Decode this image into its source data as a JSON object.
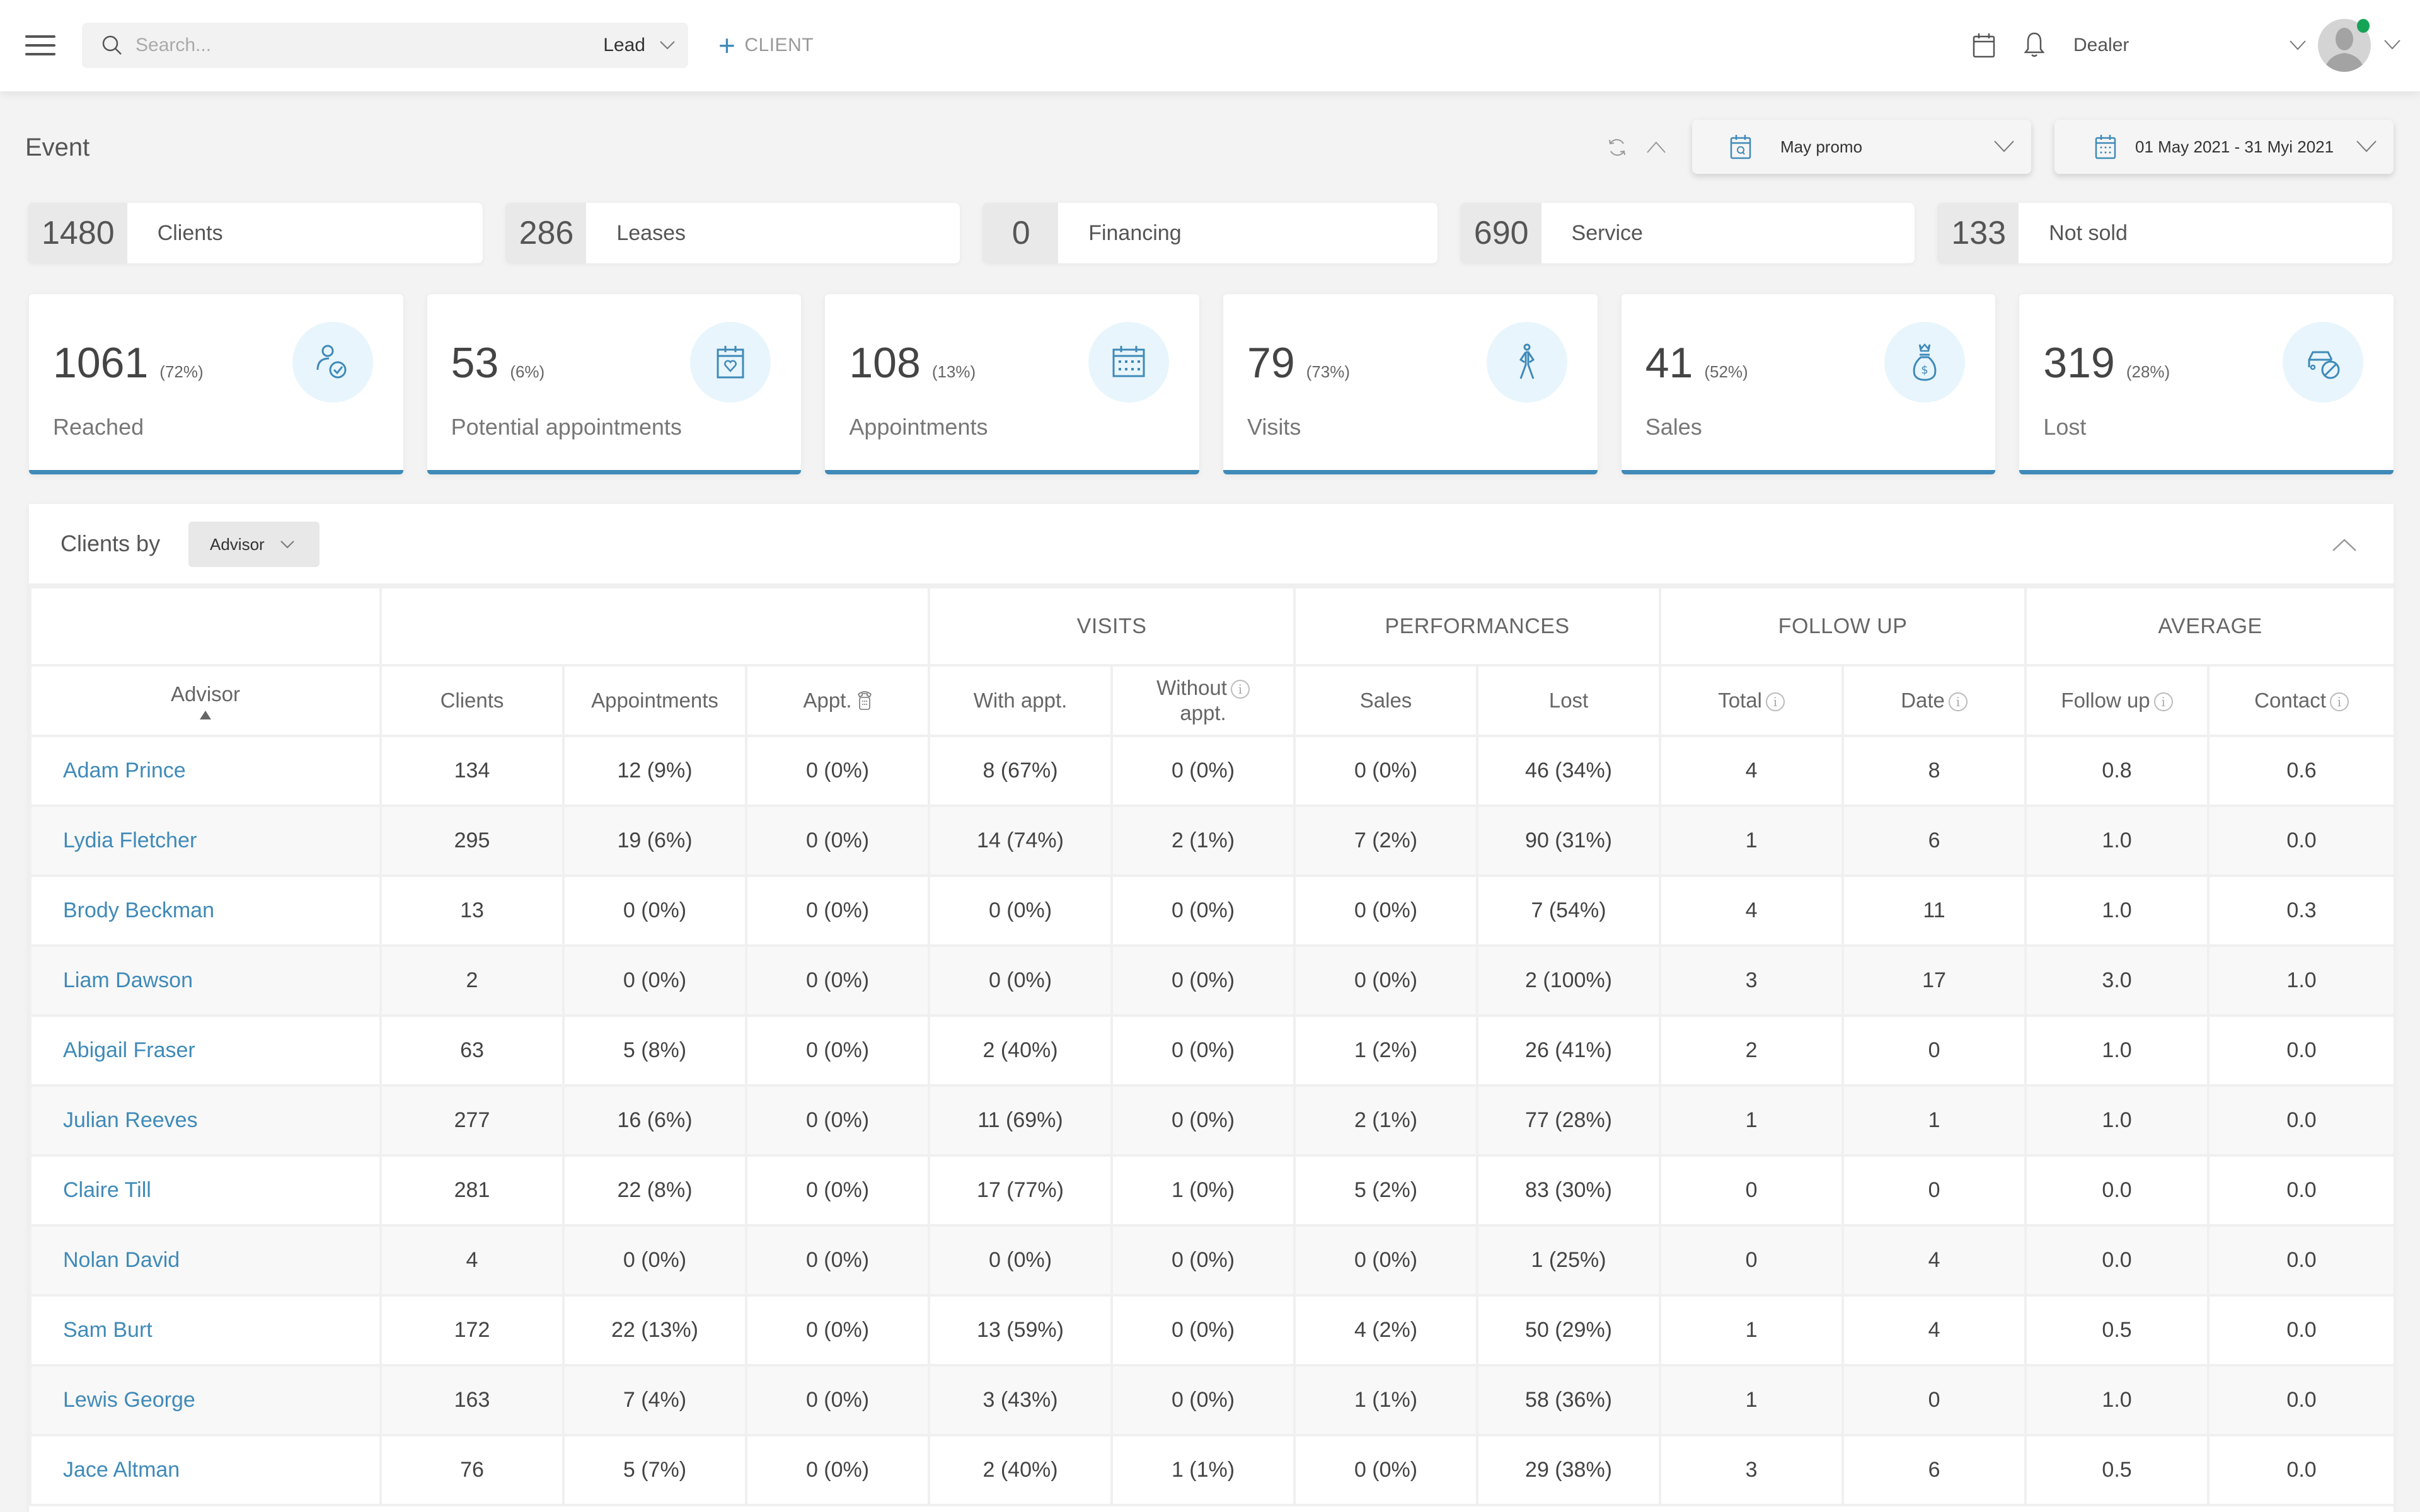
{
  "topbar": {
    "search_placeholder": "Search...",
    "search_scope": "Lead",
    "add_client_label": "CLIENT",
    "dealer_label": "Dealer",
    "online_status_color": "#15a356"
  },
  "event": {
    "title": "Event",
    "campaign_select": "May promo",
    "date_range_select": "01 May 2021 - 31 Myi 2021"
  },
  "pills": [
    {
      "value": "1480",
      "label": "Clients"
    },
    {
      "value": "286",
      "label": "Leases"
    },
    {
      "value": "0",
      "label": "Financing"
    },
    {
      "value": "690",
      "label": "Service"
    },
    {
      "value": "133",
      "label": "Not sold"
    }
  ],
  "kpis": [
    {
      "value": "1061",
      "pct": "(72%)",
      "label": "Reached",
      "icon": "user-check-icon"
    },
    {
      "value": "53",
      "pct": "(6%)",
      "label": "Potential appointments",
      "icon": "calendar-heart-icon"
    },
    {
      "value": "108",
      "pct": "(13%)",
      "label": "Appointments",
      "icon": "calendar-grid-icon"
    },
    {
      "value": "79",
      "pct": "(73%)",
      "label": "Visits",
      "icon": "walking-person-icon"
    },
    {
      "value": "41",
      "pct": "(52%)",
      "label": "Sales",
      "icon": "money-bag-icon"
    },
    {
      "value": "319",
      "pct": "(28%)",
      "label": "Lost",
      "icon": "car-blocked-icon"
    }
  ],
  "accent_color": "#3f8ab8",
  "clients_table": {
    "title": "Clients by",
    "group_by": "Advisor",
    "groups": {
      "visits": "VISITS",
      "performances": "PERFORMANCES",
      "follow_up": "FOLLOW UP",
      "average": "AVERAGE"
    },
    "columns": {
      "advisor": "Advisor",
      "clients": "Clients",
      "appointments": "Appointments",
      "appt_phone": "Appt.",
      "with_appt": "With appt.",
      "without_appt_1": "Without",
      "without_appt_2": "appt.",
      "sales": "Sales",
      "lost": "Lost",
      "total": "Total",
      "date": "Date",
      "follow_up": "Follow up",
      "contact": "Contact"
    },
    "rows": [
      {
        "advisor": "Adam Prince",
        "clients": "134",
        "appointments": "12 (9%)",
        "appt_phone": "0 (0%)",
        "with_appt": "8 (67%)",
        "without_appt": "0 (0%)",
        "sales": "0 (0%)",
        "lost": "46 (34%)",
        "total": "4",
        "date": "8",
        "avg_follow_up": "0.8",
        "avg_contact": "0.6"
      },
      {
        "advisor": "Lydia Fletcher",
        "clients": "295",
        "appointments": "19 (6%)",
        "appt_phone": "0 (0%)",
        "with_appt": "14 (74%)",
        "without_appt": "2 (1%)",
        "sales": "7 (2%)",
        "lost": "90 (31%)",
        "total": "1",
        "date": "6",
        "avg_follow_up": "1.0",
        "avg_contact": "0.0"
      },
      {
        "advisor": "Brody Beckman",
        "clients": "13",
        "appointments": "0 (0%)",
        "appt_phone": "0 (0%)",
        "with_appt": "0 (0%)",
        "without_appt": "0 (0%)",
        "sales": "0 (0%)",
        "lost": "7 (54%)",
        "total": "4",
        "date": "11",
        "avg_follow_up": "1.0",
        "avg_contact": "0.3"
      },
      {
        "advisor": "Liam Dawson",
        "clients": "2",
        "appointments": "0 (0%)",
        "appt_phone": "0 (0%)",
        "with_appt": "0 (0%)",
        "without_appt": "0 (0%)",
        "sales": "0 (0%)",
        "lost": "2 (100%)",
        "total": "3",
        "date": "17",
        "avg_follow_up": "3.0",
        "avg_contact": "1.0"
      },
      {
        "advisor": "Abigail Fraser",
        "clients": "63",
        "appointments": "5 (8%)",
        "appt_phone": "0 (0%)",
        "with_appt": "2 (40%)",
        "without_appt": "0 (0%)",
        "sales": "1 (2%)",
        "lost": "26 (41%)",
        "total": "2",
        "date": "0",
        "avg_follow_up": "1.0",
        "avg_contact": "0.0"
      },
      {
        "advisor": "Julian Reeves",
        "clients": "277",
        "appointments": "16 (6%)",
        "appt_phone": "0 (0%)",
        "with_appt": "11 (69%)",
        "without_appt": "0 (0%)",
        "sales": "2 (1%)",
        "lost": "77 (28%)",
        "total": "1",
        "date": "1",
        "avg_follow_up": "1.0",
        "avg_contact": "0.0"
      },
      {
        "advisor": "Claire Till",
        "clients": "281",
        "appointments": "22 (8%)",
        "appt_phone": "0 (0%)",
        "with_appt": "17 (77%)",
        "without_appt": "1 (0%)",
        "sales": "5 (2%)",
        "lost": "83 (30%)",
        "total": "0",
        "date": "0",
        "avg_follow_up": "0.0",
        "avg_contact": "0.0"
      },
      {
        "advisor": "Nolan David",
        "clients": "4",
        "appointments": "0 (0%)",
        "appt_phone": "0 (0%)",
        "with_appt": "0 (0%)",
        "without_appt": "0 (0%)",
        "sales": "0 (0%)",
        "lost": "1 (25%)",
        "total": "0",
        "date": "4",
        "avg_follow_up": "0.0",
        "avg_contact": "0.0"
      },
      {
        "advisor": "Sam Burt",
        "clients": "172",
        "appointments": "22 (13%)",
        "appt_phone": "0 (0%)",
        "with_appt": "13 (59%)",
        "without_appt": "0 (0%)",
        "sales": "4 (2%)",
        "lost": "50 (29%)",
        "total": "1",
        "date": "4",
        "avg_follow_up": "0.5",
        "avg_contact": "0.0"
      },
      {
        "advisor": "Lewis George",
        "clients": "163",
        "appointments": "7 (4%)",
        "appt_phone": "0 (0%)",
        "with_appt": "3 (43%)",
        "without_appt": "0 (0%)",
        "sales": "1 (1%)",
        "lost": "58 (36%)",
        "total": "1",
        "date": "0",
        "avg_follow_up": "1.0",
        "avg_contact": "0.0"
      },
      {
        "advisor": "Jace Altman",
        "clients": "76",
        "appointments": "5 (7%)",
        "appt_phone": "0 (0%)",
        "with_appt": "2 (40%)",
        "without_appt": "1 (1%)",
        "sales": "0 (0%)",
        "lost": "29 (38%)",
        "total": "3",
        "date": "6",
        "avg_follow_up": "0.5",
        "avg_contact": "0.0"
      }
    ]
  }
}
